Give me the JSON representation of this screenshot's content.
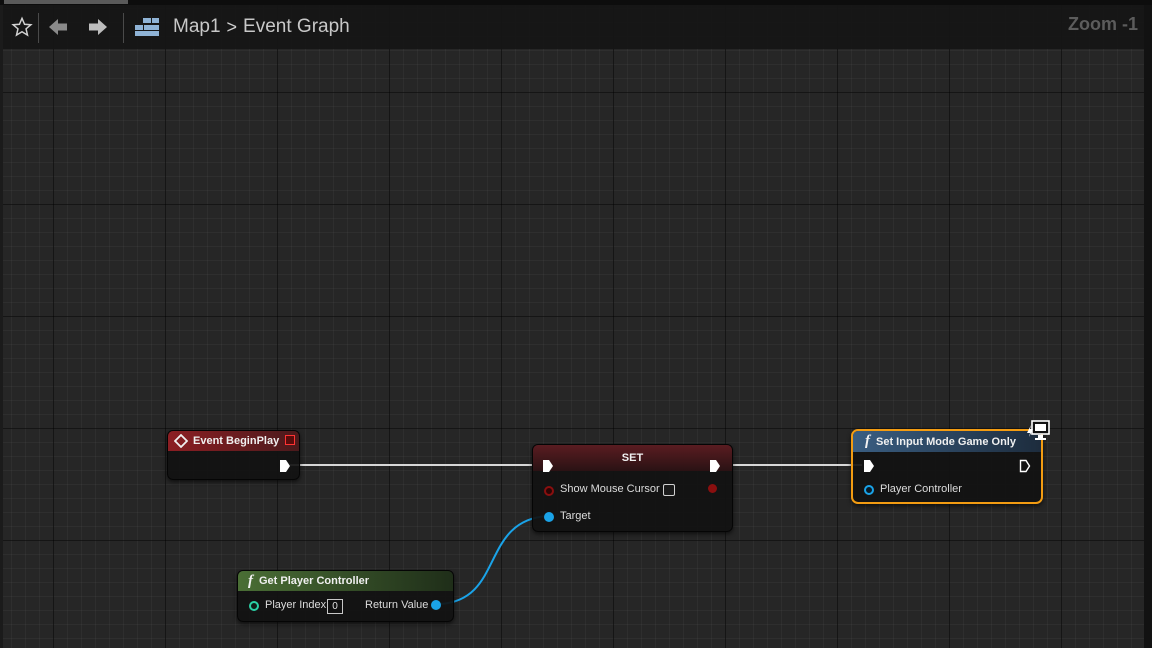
{
  "breadcrumb": {
    "root": "Map1",
    "separator": ">",
    "current": "Event Graph"
  },
  "zoom_label": "Zoom -1",
  "toolbar_icons": [
    "star-icon",
    "back-arrow-icon",
    "forward-arrow-icon",
    "graph-tree-icon"
  ],
  "nodes": {
    "begin_play": {
      "title": "Event BeginPlay",
      "header_color": "#7c1b1f"
    },
    "set": {
      "title": "SET",
      "header_color": "#4e1a1f",
      "show_mouse_cursor": "Show Mouse Cursor",
      "show_mouse_cursor_checked": false,
      "target": "Target"
    },
    "get_player_controller": {
      "title": "Get Player Controller",
      "header_color": "#3d5a2c",
      "player_index_label": "Player Index",
      "player_index_value": "0",
      "return_value": "Return Value"
    },
    "set_input_mode": {
      "title": "Set Input Mode Game Only",
      "header_color": "#2e4a66",
      "player_controller": "Player Controller",
      "selected": true,
      "selection_color": "#f39c12"
    }
  },
  "colors": {
    "exec": "#ffffff",
    "object_pin": "#1aa3e8",
    "bool_pin": "#8a0f0f",
    "player_index_pin": "#2ad1a6"
  }
}
